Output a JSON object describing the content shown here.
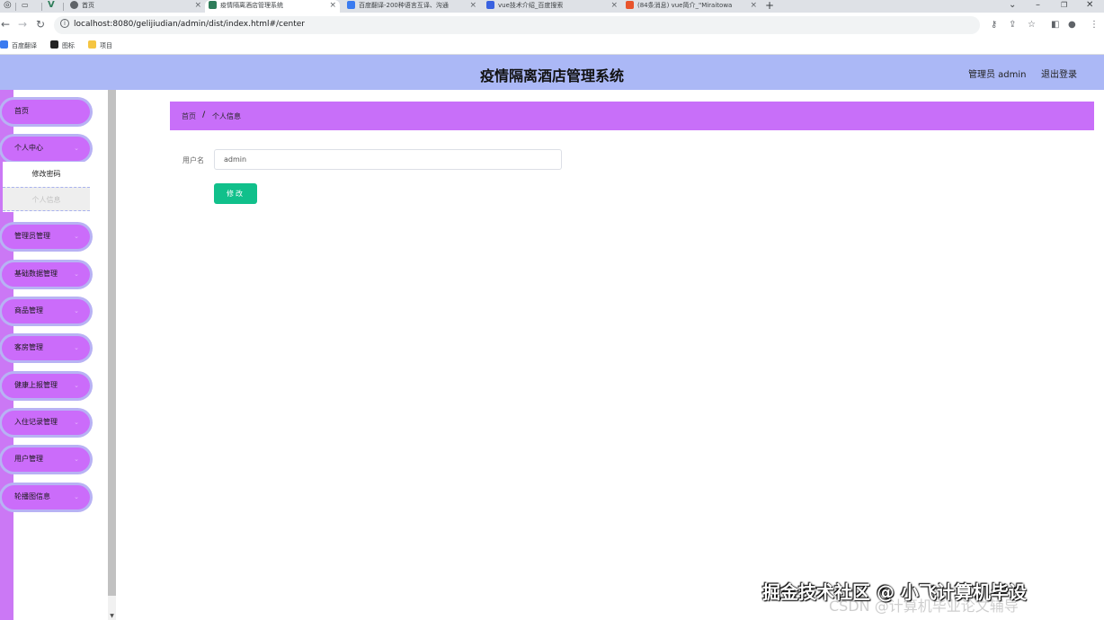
{
  "browser": {
    "tabs": [
      {
        "title": "首页",
        "favicon_color": "#5f6368"
      },
      {
        "title": "疫情隔离酒店管理系统",
        "favicon_color": "#2f7d5a"
      },
      {
        "title": "百度翻译-200种语言互译、沟通",
        "favicon_color": "#3a7bf0"
      },
      {
        "title": "vue技术介绍_百度搜索",
        "favicon_color": "#3a62e0"
      },
      {
        "title": "(84条消息) vue简介_\"Miraitowa",
        "favicon_color": "#e8542c"
      }
    ],
    "new_tab": "+",
    "url": "localhost:8080/gelijiudian/admin/dist/index.html#/center",
    "bookmarks": [
      {
        "label": "百度翻译",
        "color": "#3a7bf0"
      },
      {
        "label": "图标",
        "color": "#222222"
      },
      {
        "label": "项目",
        "color": "#f5c542"
      }
    ]
  },
  "header": {
    "title": "疫情隔离酒店管理系统",
    "user": "管理员 admin",
    "logout": "退出登录"
  },
  "sidebar": {
    "items": [
      {
        "label": "首页",
        "has_chevron": false
      },
      {
        "label": "个人中心",
        "has_chevron": true
      },
      {
        "label": "管理员管理",
        "has_chevron": true
      },
      {
        "label": "基础数据管理",
        "has_chevron": true
      },
      {
        "label": "商品管理",
        "has_chevron": true
      },
      {
        "label": "客房管理",
        "has_chevron": true
      },
      {
        "label": "健康上报管理",
        "has_chevron": true
      },
      {
        "label": "入住记录管理",
        "has_chevron": true
      },
      {
        "label": "用户管理",
        "has_chevron": true
      },
      {
        "label": "轮播图信息",
        "has_chevron": true
      }
    ],
    "submenu": [
      {
        "label": "修改密码",
        "active": false
      },
      {
        "label": "个人信息",
        "active": true
      }
    ]
  },
  "breadcrumb": {
    "home": "首页",
    "separator": "/",
    "current": "个人信息"
  },
  "form": {
    "username_label": "用户名",
    "username_value": "admin",
    "submit_label": "修改"
  },
  "watermark": {
    "line1": "掘金技术社区 @ 小飞计算机毕设",
    "line2": "CSDN @计算机毕业论文辅导"
  },
  "colors": {
    "header_bg": "#abb8f6",
    "menu_bg": "#cb6cfa",
    "breadcrumb_bg": "#c86ff9",
    "button_bg": "#11c08b"
  }
}
